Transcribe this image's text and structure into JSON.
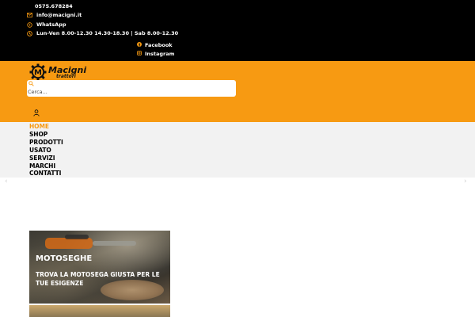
{
  "topbar": {
    "phone": "0575.678284",
    "email": "info@macigni.it",
    "whatsapp": "WhatsApp",
    "hours": "Lun-Ven 8.00-12.30 14.30-18.30 | Sab 8.00-12.30",
    "facebook": "Facebook",
    "instagram": "Instagram",
    "icon_color": "#f79a12"
  },
  "header": {
    "background": "#f79a12",
    "logo_title": "Macigni",
    "logo_subtitle": "trattori",
    "logo_letter": "M",
    "search_placeholder": "Cerca..."
  },
  "nav": {
    "items": [
      {
        "label": "HOME",
        "active": true
      },
      {
        "label": "SHOP",
        "active": false
      },
      {
        "label": "PRODOTTI",
        "active": false
      },
      {
        "label": "USATO",
        "active": false
      },
      {
        "label": "SERVIZI",
        "active": false
      },
      {
        "label": "MARCHI",
        "active": false
      },
      {
        "label": "CONTATTI",
        "active": false
      }
    ]
  },
  "slider": {
    "prev_glyph": "‹",
    "next_glyph": "›"
  },
  "cards": [
    {
      "title": "MOTOSEGHE",
      "subtitle": "TROVA LA MOTOSEGA GIUSTA PER LE TUE ESIGENZE"
    }
  ]
}
